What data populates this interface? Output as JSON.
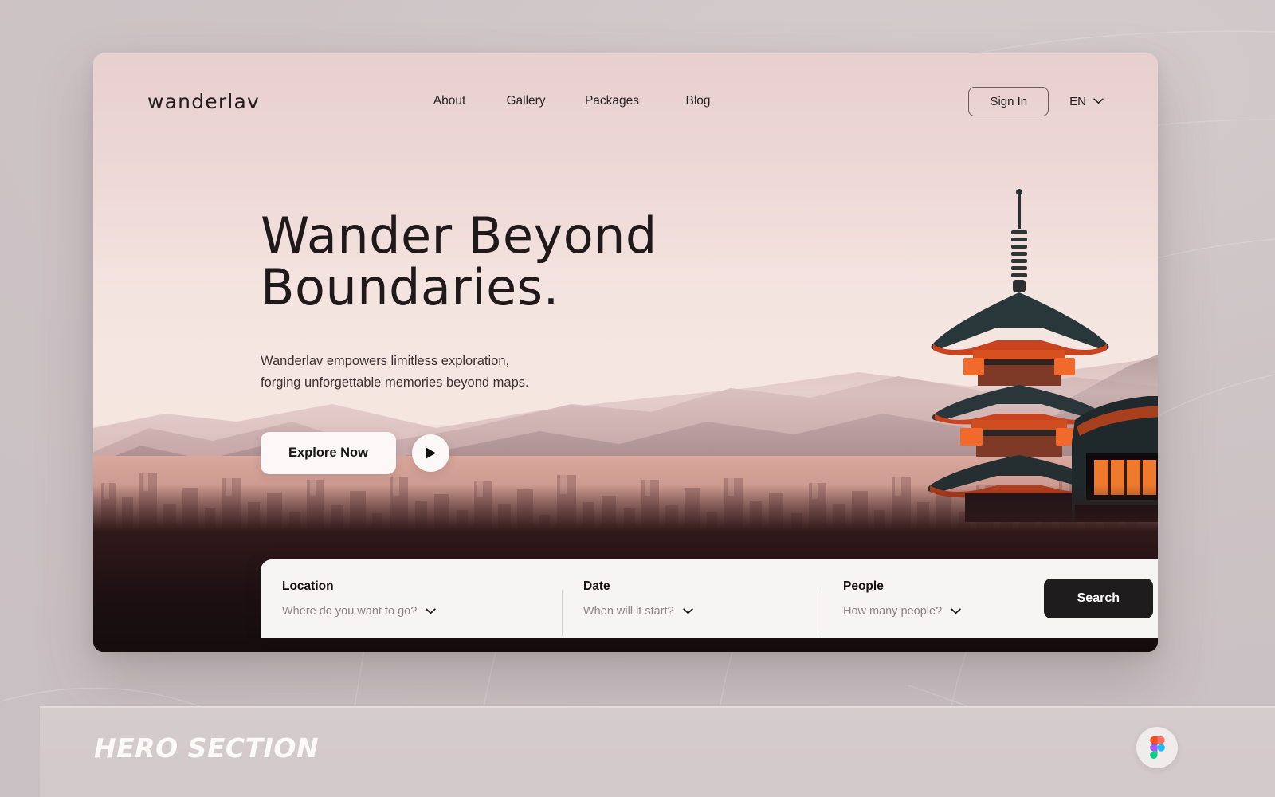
{
  "brand": {
    "name": "wanderlav"
  },
  "nav": {
    "links": [
      {
        "label": "About"
      },
      {
        "label": "Gallery"
      },
      {
        "label": "Packages"
      },
      {
        "label": "Blog"
      }
    ],
    "sign_in_label": "Sign In",
    "language": "EN",
    "language_chevron_icon": "chevron-down-icon"
  },
  "hero": {
    "headline": "Wander Beyond\nBoundaries.",
    "subtext": "Wanderlav empowers limitless exploration,\nforging unforgettable memories beyond maps.",
    "primary_cta": "Explore Now",
    "play_icon": "play-icon"
  },
  "search": {
    "fields": [
      {
        "label": "Location",
        "placeholder": "Where do you want to go?",
        "chevron_icon": "chevron-down-icon"
      },
      {
        "label": "Date",
        "placeholder": "When will it start?",
        "chevron_icon": "chevron-down-icon"
      },
      {
        "label": "People",
        "placeholder": "How many people?",
        "chevron_icon": "chevron-down-icon"
      }
    ],
    "submit_label": "Search"
  },
  "footer": {
    "section_label": "HERO SECTION",
    "badge_icon": "figma-logo-icon"
  },
  "colors": {
    "page_background": "#cdc4c6",
    "hero_sky": "#eed9d7",
    "text_dark": "#20191a",
    "search_panel": "#f7f5f4",
    "search_button": "#1e1c1c",
    "placeholder": "#8b8584",
    "figma_red": "#f24e1e",
    "figma_orange": "#ff7262",
    "figma_purple": "#a259ff",
    "figma_blue": "#1abcfe",
    "figma_green": "#0acf83"
  }
}
